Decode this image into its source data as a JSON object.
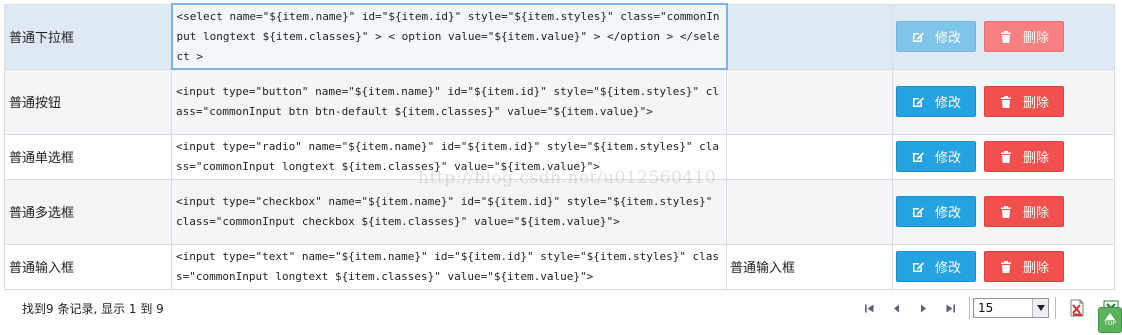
{
  "rows": [
    {
      "label": "普通下拉框",
      "code": "<select name=\"${item.name}\" id=\"${item.id}\" style=\"${item.styles}\" class=\"commonInput longtext ${item.classes}\" > < option value=\"${item.value}\" > </option > </select >",
      "value": "",
      "edit_label": "修改",
      "delete_label": "删除"
    },
    {
      "label": "普通按钮",
      "code": "<input type=\"button\" name=\"${item.name}\" id=\"${item.id}\" style=\"${item.styles}\" class=\"commonInput btn btn-default ${item.classes}\" value=\"${item.value}\">",
      "value": "",
      "edit_label": "修改",
      "delete_label": "删除"
    },
    {
      "label": "普通单选框",
      "code": "<input type=\"radio\" name=\"${item.name}\" id=\"${item.id}\" style=\"${item.styles}\" class=\"commonInput longtext ${item.classes}\" value=\"${item.value}\">",
      "value": "",
      "edit_label": "修改",
      "delete_label": "删除"
    },
    {
      "label": "普通多选框",
      "code": "<input type=\"checkbox\" name=\"${item.name}\" id=\"${item.id}\" style=\"${item.styles}\" class=\"commonInput checkbox ${item.classes}\" value=\"${item.value}\">",
      "value": "",
      "edit_label": "修改",
      "delete_label": "删除"
    },
    {
      "label": "普通输入框",
      "code": "<input type=\"text\" name=\"${item.name}\" id=\"${item.id}\" style=\"${item.styles}\" class=\"commonInput longtext ${item.classes}\" value=\"${item.value}\">",
      "value": "普通输入框",
      "edit_label": "修改",
      "delete_label": "删除"
    }
  ],
  "watermark": "http://blog.csdn.net/u012560410",
  "footer": {
    "record_info": "找到9 条记录, 显示 1 到 9",
    "page_size": "15"
  },
  "top_button_label": "TOP",
  "icons": {
    "edit": "edit-icon",
    "delete": "trash-icon",
    "first": "first-page-icon",
    "prev": "prev-page-icon",
    "next": "next-page-icon",
    "last": "last-page-icon",
    "export_pdf": "pdf-export-icon",
    "export_excel": "excel-export-icon",
    "top": "back-to-top-icon"
  },
  "colors": {
    "edit_button": "#25a2e2",
    "delete_button": "#f0514f",
    "selected_row": "#dfe9f4",
    "alt_row": "#f4f5f7",
    "top_button": "#5ab35a"
  }
}
